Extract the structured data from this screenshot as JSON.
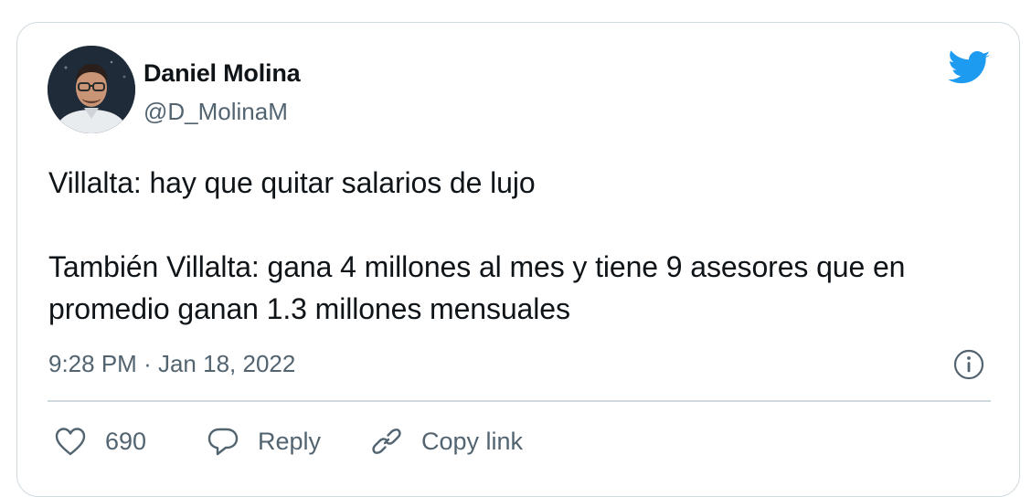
{
  "tweet": {
    "author": {
      "display_name": "Daniel Molina",
      "handle": "@D_MolinaM"
    },
    "text": "Villalta: hay que quitar salarios de lujo\n\nTambién Villalta: gana 4 millones al mes y tiene 9 asesores que en promedio ganan 1.3 millones mensuales",
    "time": "9:28 PM",
    "separator": "·",
    "date": "Jan 18, 2022"
  },
  "actions": {
    "like_count": "690",
    "reply_label": "Reply",
    "copy_label": "Copy link"
  },
  "icons": {
    "brand": "twitter-bird-icon",
    "info": "info-icon",
    "like": "heart-icon",
    "reply": "speech-bubble-icon",
    "copy": "link-icon"
  },
  "colors": {
    "twitter_blue": "#1d9bf0",
    "text_primary": "#0f1419",
    "text_secondary": "#536471",
    "border": "#cfd9de"
  }
}
